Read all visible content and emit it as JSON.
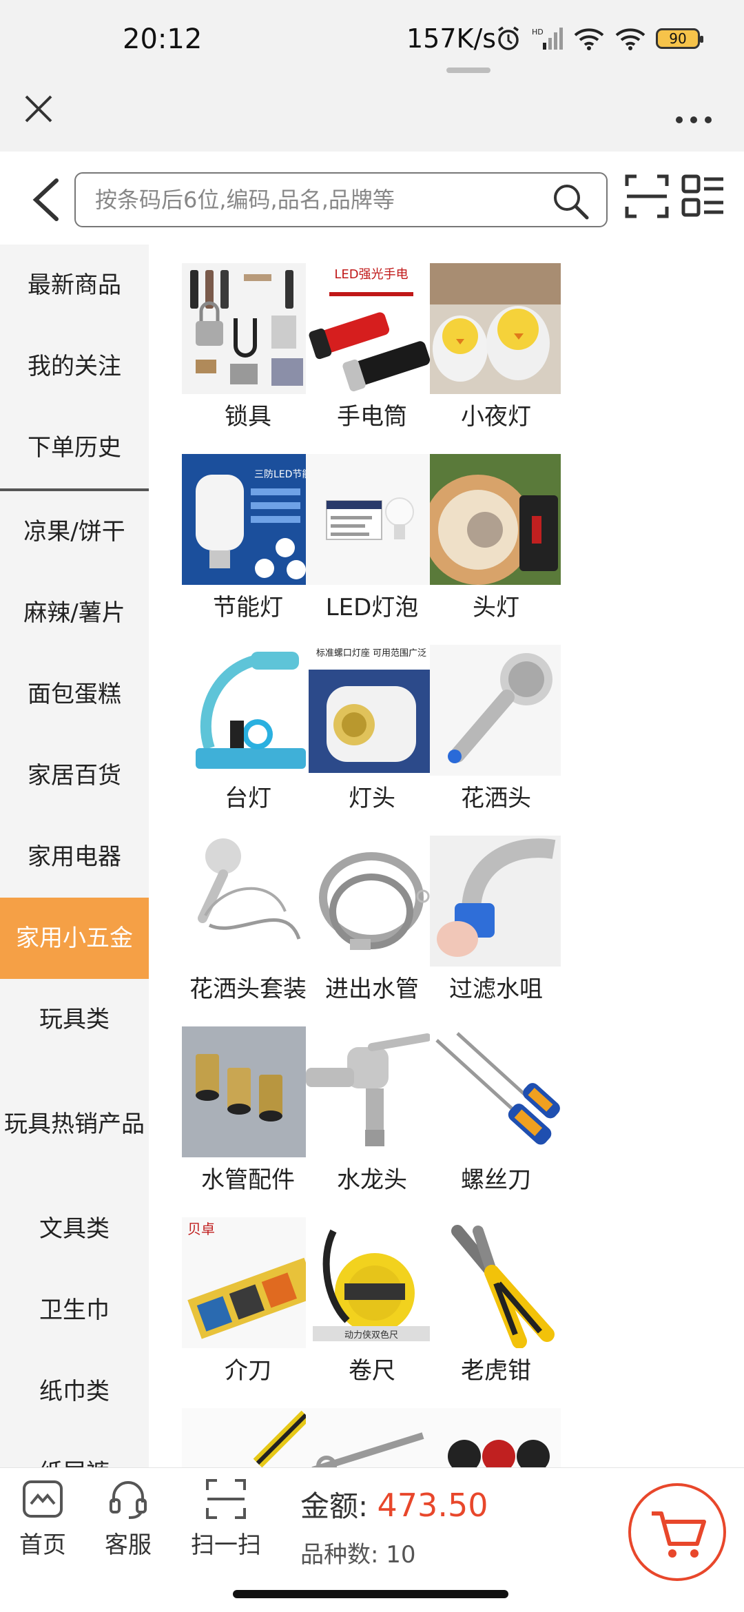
{
  "status_bar": {
    "time": "20:12",
    "network_speed": "157K/s",
    "battery": "90"
  },
  "search": {
    "placeholder": "按条码后6位,编码,品名,品牌等"
  },
  "sidebar": {
    "items": [
      {
        "label": "最新商品"
      },
      {
        "label": "我的关注"
      },
      {
        "label": "下单历史"
      },
      {
        "label": "凉果/饼干"
      },
      {
        "label": "麻辣/薯片"
      },
      {
        "label": "面包蛋糕"
      },
      {
        "label": "家居百货"
      },
      {
        "label": "家用电器"
      },
      {
        "label": "家用小五金",
        "active": true
      },
      {
        "label": "玩具类"
      },
      {
        "label": "玩具热销产品"
      },
      {
        "label": "文具类"
      },
      {
        "label": "卫生巾"
      },
      {
        "label": "纸巾类"
      },
      {
        "label": "纸尿裤"
      }
    ]
  },
  "products": [
    {
      "name": "锁具"
    },
    {
      "name": "手电筒",
      "image_text": "LED强光手电"
    },
    {
      "name": "小夜灯"
    },
    {
      "name": "节能灯",
      "image_text": "三防LED节能灯"
    },
    {
      "name": "LED灯泡"
    },
    {
      "name": "头灯"
    },
    {
      "name": "台灯"
    },
    {
      "name": "灯头",
      "image_text": "标准螺口灯座 可用范围广泛"
    },
    {
      "name": "花洒头"
    },
    {
      "name": "花洒头套装"
    },
    {
      "name": "进出水管"
    },
    {
      "name": "过滤水咀"
    },
    {
      "name": "水管配件"
    },
    {
      "name": "水龙头"
    },
    {
      "name": "螺丝刀"
    },
    {
      "name": "介刀",
      "image_text": "贝卓"
    },
    {
      "name": "卷尺",
      "image_text": "动力侠双色尺"
    },
    {
      "name": "老虎钳"
    }
  ],
  "bottom_bar": {
    "tabs": [
      {
        "label": "首页",
        "icon": "home-icon"
      },
      {
        "label": "客服",
        "icon": "headset-icon"
      },
      {
        "label": "扫一扫",
        "icon": "scan-icon"
      }
    ],
    "amount_label": "金额:",
    "amount_value": "473.50",
    "count_label": "品种数:",
    "count_value": "10"
  },
  "colors": {
    "accent": "#f5a046",
    "price": "#e8472b"
  }
}
